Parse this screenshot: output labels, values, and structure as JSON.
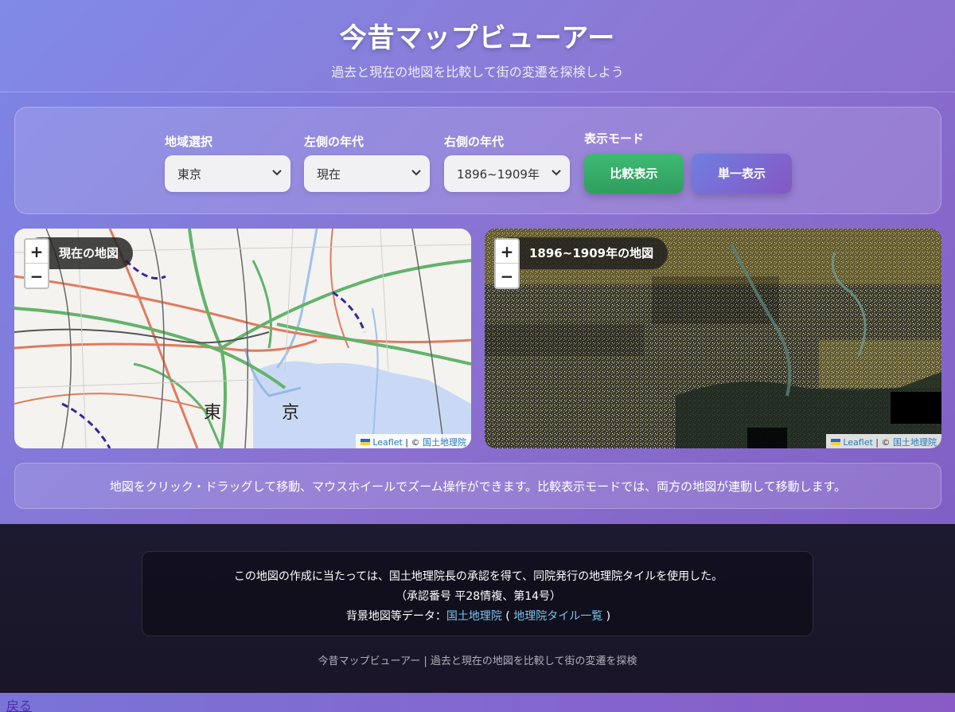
{
  "header": {
    "title": "今昔マップビューアー",
    "subtitle": "過去と現在の地図を比較して街の変遷を探検しよう"
  },
  "controls": {
    "region_label": "地域選択",
    "region_value": "東京",
    "left_year_label": "左側の年代",
    "left_year_value": "現在",
    "right_year_label": "右側の年代",
    "right_year_value": "1896~1909年",
    "mode_label": "表示モード",
    "compare_button": "比較表示",
    "single_button": "単一表示"
  },
  "maps": {
    "left": {
      "label": "現在の地図",
      "zoom_in": "+",
      "zoom_out": "−",
      "attribution_leaflet": "Leaflet",
      "attribution_sep": " | © ",
      "attribution_gsi": "国土地理院",
      "place_1": "東",
      "place_2": "京"
    },
    "right": {
      "label": "1896~1909年の地図",
      "zoom_in": "+",
      "zoom_out": "−",
      "attribution_leaflet": "Leaflet",
      "attribution_sep": " | © ",
      "attribution_gsi": "国土地理院"
    }
  },
  "info": {
    "text": "地図をクリック・ドラッグして移動、マウスホイールでズーム操作ができます。比較表示モードでは、両方の地図が連動して移動します。"
  },
  "footer": {
    "credit_line1": "この地図の作成に当たっては、国土地理院長の承認を得て、同院発行の地理院タイルを使用した。",
    "credit_line2": "（承認番号 平28情複、第14号）",
    "credit_line3_prefix": "背景地図等データ：",
    "credit_link_gsi": "国土地理院",
    "credit_paren_open": " ( ",
    "credit_link_tiles": "地理院タイル一覧",
    "credit_paren_close": " )",
    "footnote": "今昔マップビューアー | 過去と現在の地図を比較して街の変遷を探検"
  },
  "back_link": "戻る"
}
